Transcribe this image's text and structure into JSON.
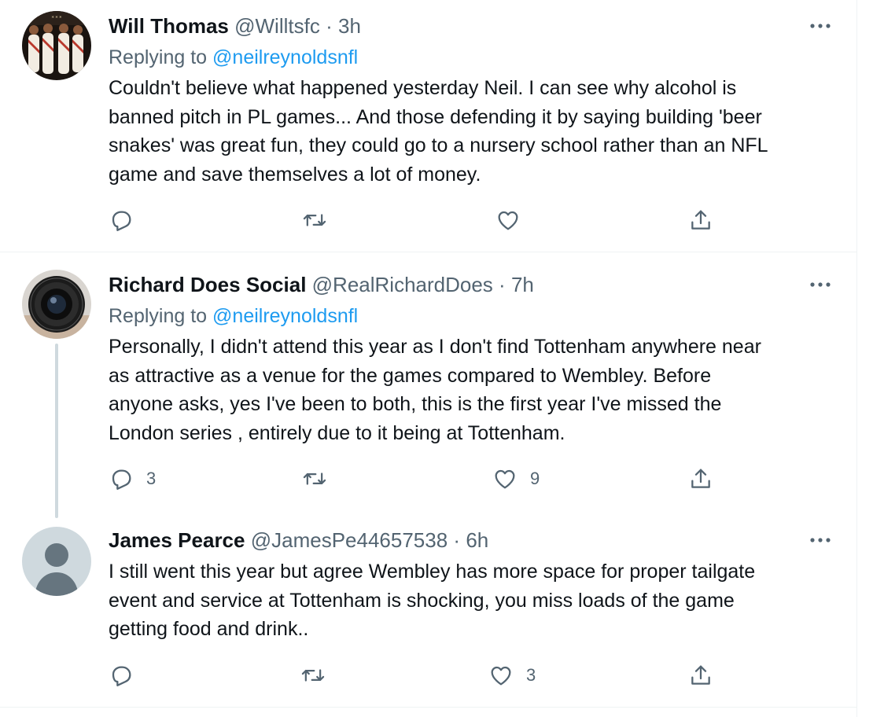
{
  "tweets": [
    {
      "name": "Will Thomas",
      "handle": "@Willtsfc",
      "separator": "·",
      "time": "3h",
      "replying_prefix": "Replying to",
      "replying_to": "@neilreynoldsnfl",
      "lines": [
        "Couldn't believe what happened yesterday Neil.  I can see why alcohol is",
        "banned pitch in PL games...  And those defending it by saying building 'beer",
        "snakes' was great fun, they could go to a nursery school rather than an NFL",
        "game and save themselves a lot of money."
      ],
      "replies": "",
      "retweets": "",
      "likes": ""
    },
    {
      "name": "Richard Does Social",
      "handle": "@RealRichardDoes",
      "separator": "·",
      "time": "7h",
      "replying_prefix": "Replying to",
      "replying_to": "@neilreynoldsnfl",
      "lines": [
        "Personally, I didn't attend this year as I don't find Tottenham anywhere near",
        "as attractive as a venue for the games compared to Wembley. Before",
        "anyone asks, yes I've been to both, this is the first year I've missed the",
        "London series , entirely due to it being at Tottenham."
      ],
      "replies": "3",
      "retweets": "",
      "likes": "9"
    },
    {
      "name": "James Pearce",
      "handle": "@JamesPe44657538",
      "separator": "·",
      "time": "6h",
      "lines": [
        "I still went this year but agree Wembley has more space for proper tailgate",
        "event and service at Tottenham is shocking, you miss loads of the game",
        "getting food and drink.."
      ],
      "replies": "",
      "retweets": "",
      "likes": "3"
    }
  ],
  "icons": {
    "reply": "reply-icon",
    "retweet": "retweet-icon",
    "like": "heart-icon",
    "share": "share-icon",
    "more": "more-icon"
  },
  "colors": {
    "text": "#0f1419",
    "secondary": "#536471",
    "link": "#1d9bf0",
    "divider": "#eff3f4"
  }
}
